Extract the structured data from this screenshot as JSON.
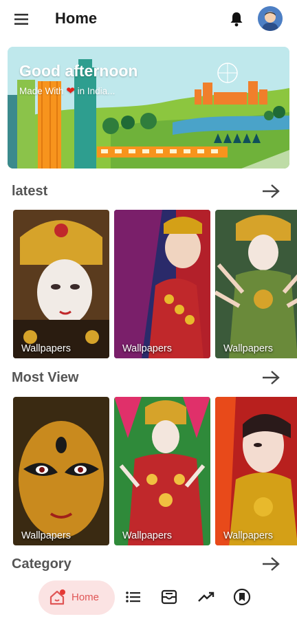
{
  "appbar": {
    "title": "Home",
    "icons": [
      "menu-icon",
      "bell-icon",
      "avatar"
    ]
  },
  "banner": {
    "greeting": "Good afternoon",
    "subtitle_before": "Made With",
    "subtitle_heart": "❤",
    "subtitle_after": "in India..."
  },
  "sections": {
    "latest": {
      "title": "latest",
      "cards": [
        {
          "label": "Wallpapers"
        },
        {
          "label": "Wallpapers"
        },
        {
          "label": "Wallpapers"
        }
      ]
    },
    "most_view": {
      "title": "Most View",
      "cards": [
        {
          "label": "Wallpapers"
        },
        {
          "label": "Wallpapers"
        },
        {
          "label": "Wallpapers"
        }
      ]
    },
    "category": {
      "title": "Category"
    }
  },
  "bottom_nav": {
    "home_label": "Home",
    "items": [
      "home-icon",
      "list-icon",
      "inbox-icon",
      "trending-icon",
      "bookmark-icon"
    ]
  },
  "colors": {
    "accent": "#e05656",
    "pill_bg": "#fbe3e3",
    "section_title": "#555555",
    "avatar": "#4d7fc4"
  }
}
